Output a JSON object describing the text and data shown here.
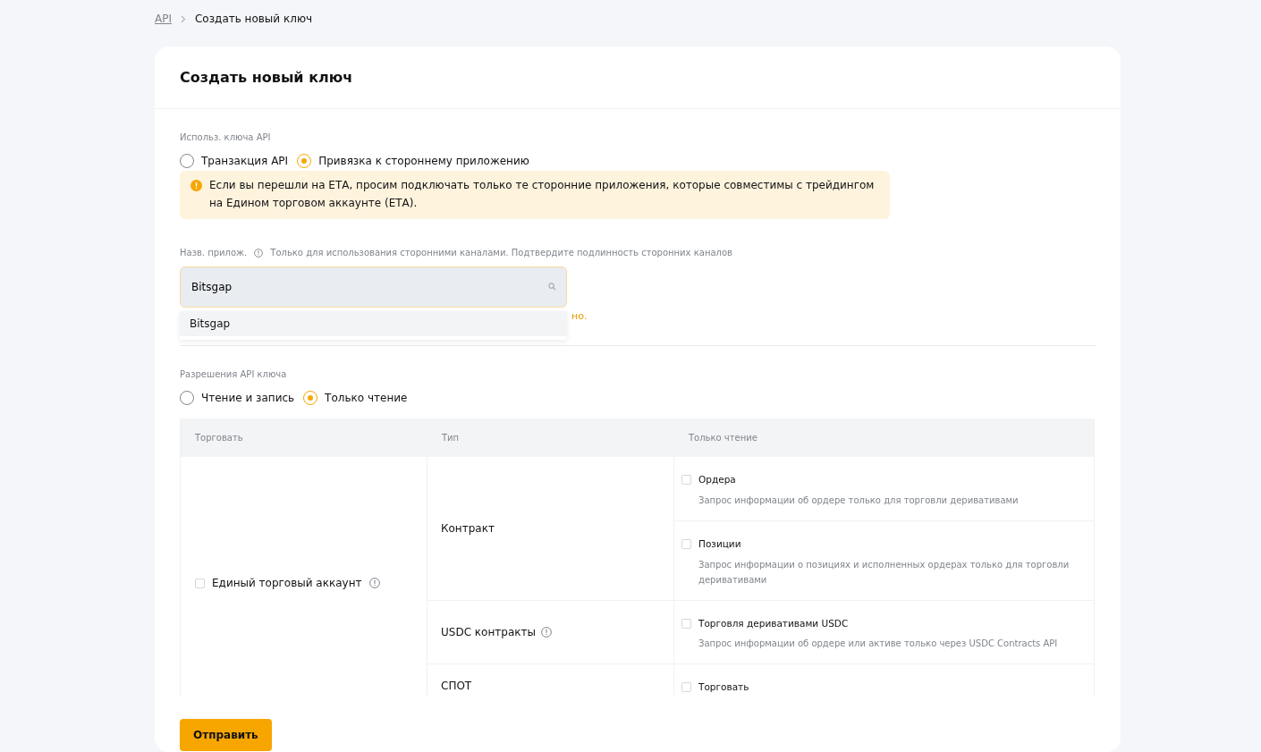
{
  "breadcrumb": [
    {
      "label": "API"
    },
    {
      "label": "Создать новый ключ"
    }
  ],
  "title": "Создать новый ключ",
  "usage": {
    "label": "Использ. ключа API",
    "options": [
      {
        "label": "Транзакция API",
        "selected": false
      },
      {
        "label": "Привязка к стороннему приложению",
        "selected": true
      }
    ]
  },
  "alert": "Если вы перешли на ЕТА, просим подключать только те сторонние приложения, которые совместимы с трейдингом на Едином торговом аккаунте (ЕТА).",
  "app_name": {
    "label": "Назв. прилож.",
    "hint": "Только для использования сторонними каналами. Подтвердите подлинность сторонних каналов",
    "value": "Bitsgap",
    "dropdown_items": [
      {
        "label": "Bitsgap"
      }
    ],
    "error_fragment": "но."
  },
  "permissions": {
    "label": "Разрешения API ключа",
    "options": [
      {
        "label": "Чтение и запись",
        "selected": false
      },
      {
        "label": "Только чтение",
        "selected": true
      }
    ]
  },
  "table": {
    "columns": [
      "Торговать",
      "Тип",
      "Только чтение"
    ],
    "group": {
      "label": "Единый торговый аккаунт",
      "checked": false,
      "info": true
    },
    "types": [
      {
        "label": "Контракт",
        "info": false,
        "items": [
          {
            "label": "Ордера",
            "description": "Запрос информации об ордере только для торговли деривативами",
            "checked": false
          },
          {
            "label": "Позиции",
            "description": "Запрос информации о позициях и исполненных ордерах только для торговли деривативами",
            "checked": false
          }
        ]
      },
      {
        "label": "USDC контракты",
        "info": true,
        "items": [
          {
            "label": "Торговля деривативами USDC",
            "description": "Запрос информации об ордере или активе только через USDC Contracts API",
            "checked": false
          }
        ]
      },
      {
        "label": "СПОТ",
        "info": false,
        "items": [
          {
            "label": "Торговать",
            "checked": false
          }
        ]
      }
    ]
  },
  "submit": "Отправить"
}
